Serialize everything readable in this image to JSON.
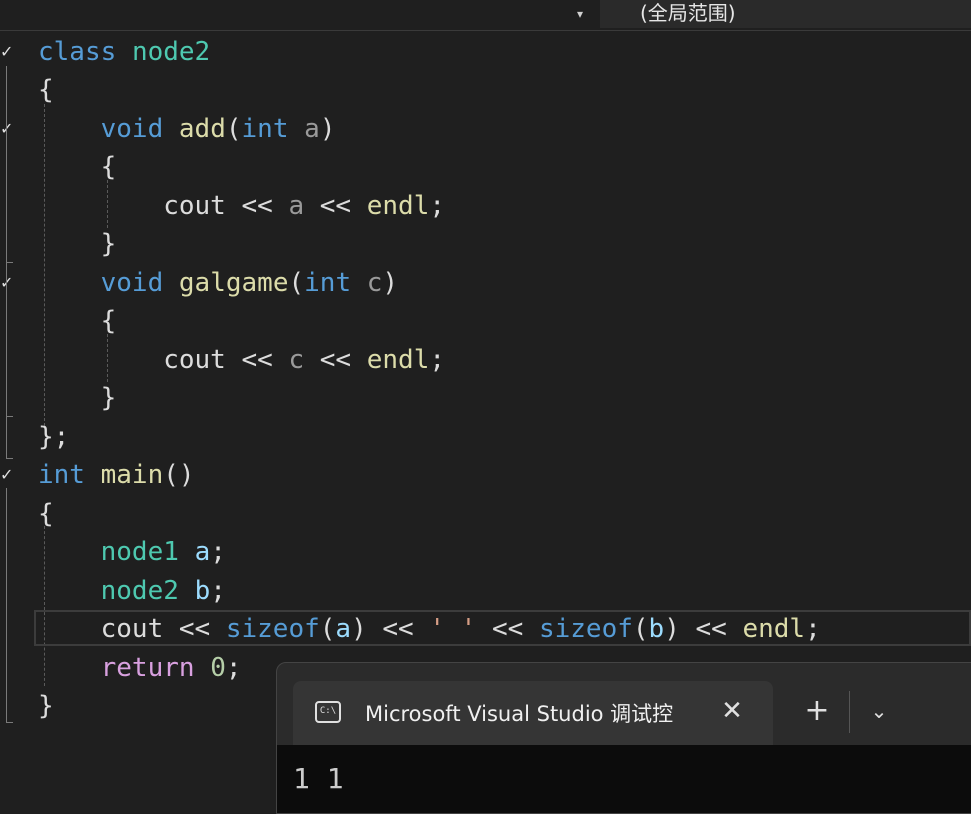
{
  "toolbar": {
    "dropdown_arrow": "▾",
    "scope_label": "(全局范围)"
  },
  "editor": {
    "fold_check": "✓",
    "lines": [
      [
        {
          "t": "class",
          "c": "kw"
        },
        {
          "t": " ",
          "c": "pl"
        },
        {
          "t": "node2",
          "c": "ty"
        }
      ],
      [
        {
          "t": "{",
          "c": "pl"
        }
      ],
      [
        {
          "t": "    ",
          "c": "pl"
        },
        {
          "t": "void",
          "c": "kw"
        },
        {
          "t": " ",
          "c": "pl"
        },
        {
          "t": "add",
          "c": "fn"
        },
        {
          "t": "(",
          "c": "pl"
        },
        {
          "t": "int",
          "c": "kw"
        },
        {
          "t": " ",
          "c": "pl"
        },
        {
          "t": "a",
          "c": "prm"
        },
        {
          "t": ")",
          "c": "pl"
        }
      ],
      [
        {
          "t": "    {",
          "c": "pl"
        }
      ],
      [
        {
          "t": "        cout ",
          "c": "pl"
        },
        {
          "t": "<<",
          "c": "pl"
        },
        {
          "t": " ",
          "c": "pl"
        },
        {
          "t": "a",
          "c": "prm"
        },
        {
          "t": " << ",
          "c": "pl"
        },
        {
          "t": "endl",
          "c": "fn"
        },
        {
          "t": ";",
          "c": "pl"
        }
      ],
      [
        {
          "t": "    }",
          "c": "pl"
        }
      ],
      [
        {
          "t": "    ",
          "c": "pl"
        },
        {
          "t": "void",
          "c": "kw"
        },
        {
          "t": " ",
          "c": "pl"
        },
        {
          "t": "galgame",
          "c": "fn"
        },
        {
          "t": "(",
          "c": "pl"
        },
        {
          "t": "int",
          "c": "kw"
        },
        {
          "t": " ",
          "c": "pl"
        },
        {
          "t": "c",
          "c": "prm"
        },
        {
          "t": ")",
          "c": "pl"
        }
      ],
      [
        {
          "t": "    {",
          "c": "pl"
        }
      ],
      [
        {
          "t": "        cout ",
          "c": "pl"
        },
        {
          "t": "<<",
          "c": "pl"
        },
        {
          "t": " ",
          "c": "pl"
        },
        {
          "t": "c",
          "c": "prm"
        },
        {
          "t": " << ",
          "c": "pl"
        },
        {
          "t": "endl",
          "c": "fn"
        },
        {
          "t": ";",
          "c": "pl"
        }
      ],
      [
        {
          "t": "    }",
          "c": "pl"
        }
      ],
      [
        {
          "t": "};",
          "c": "pl"
        }
      ],
      [
        {
          "t": "int",
          "c": "kw"
        },
        {
          "t": " ",
          "c": "pl"
        },
        {
          "t": "main",
          "c": "fn"
        },
        {
          "t": "()",
          "c": "pl"
        }
      ],
      [
        {
          "t": "{",
          "c": "pl"
        }
      ],
      [
        {
          "t": "    ",
          "c": "pl"
        },
        {
          "t": "node1",
          "c": "ty"
        },
        {
          "t": " ",
          "c": "pl"
        },
        {
          "t": "a",
          "c": "var"
        },
        {
          "t": ";",
          "c": "pl"
        }
      ],
      [
        {
          "t": "    ",
          "c": "pl"
        },
        {
          "t": "node2",
          "c": "ty"
        },
        {
          "t": " ",
          "c": "pl"
        },
        {
          "t": "b",
          "c": "var"
        },
        {
          "t": ";",
          "c": "pl"
        }
      ],
      [
        {
          "t": "    cout << ",
          "c": "pl"
        },
        {
          "t": "sizeof",
          "c": "kw"
        },
        {
          "t": "(",
          "c": "pl"
        },
        {
          "t": "a",
          "c": "var"
        },
        {
          "t": ") << ",
          "c": "pl"
        },
        {
          "t": "' '",
          "c": "str"
        },
        {
          "t": " << ",
          "c": "pl"
        },
        {
          "t": "sizeof",
          "c": "kw"
        },
        {
          "t": "(",
          "c": "pl"
        },
        {
          "t": "b",
          "c": "var"
        },
        {
          "t": ") << ",
          "c": "pl"
        },
        {
          "t": "endl",
          "c": "fn"
        },
        {
          "t": ";",
          "c": "pl"
        }
      ],
      [
        {
          "t": "    ",
          "c": "pl"
        },
        {
          "t": "return",
          "c": "kw2"
        },
        {
          "t": " ",
          "c": "pl"
        },
        {
          "t": "0",
          "c": "num"
        },
        {
          "t": ";",
          "c": "pl"
        }
      ],
      [
        {
          "t": "}",
          "c": "pl"
        }
      ]
    ]
  },
  "terminal": {
    "icon_text": "C:\\",
    "title": "Microsoft Visual Studio 调试控",
    "close_glyph": "✕",
    "plus_glyph": "+",
    "chevron_glyph": "⌄",
    "output": "1 1"
  }
}
